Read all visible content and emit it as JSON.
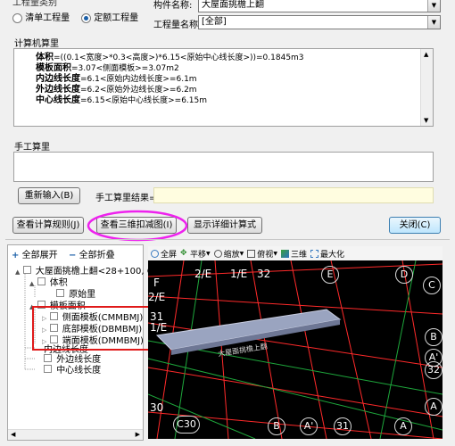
{
  "top": {
    "section_label": "工程量类别",
    "radio_list": "清单工程量",
    "radio_quota": "定额工程量",
    "component_name_label": "构件名称:",
    "component_name_value": "大屋面挑檐上翻",
    "quantity_name_label": "工程量名称:",
    "quantity_name_value": "[全部]"
  },
  "computer_calc": {
    "title": "计算机算里",
    "lines": [
      {
        "name": "体积",
        "expr": "=((0.1<宽度>*0.3<高度>)*6.15<原始中心线长度>))=0.1845m3"
      },
      {
        "name": "模板面积",
        "expr": "=3.07<侧面模板>=3.07m2"
      },
      {
        "name": "内边线长度",
        "expr": "=6.1<原始内边线长度>=6.1m"
      },
      {
        "name": "外边线长度",
        "expr": "=6.2<原始外边线长度>=6.2m"
      },
      {
        "name": "中心线长度",
        "expr": "=6.15<原始中心线长度>=6.15m"
      }
    ]
  },
  "manual_calc": {
    "title": "手工算里",
    "reenter_button": "重新输入(B)",
    "result_label": "手工算里结果="
  },
  "actions": {
    "view_rules": "查看计算规则(J)",
    "view_3d": "查看三维扣减图(I)",
    "show_detail": "显示详细计算式",
    "close": "关闭(C)"
  },
  "tree": {
    "expand_all": "全部展开",
    "collapse_all": "全部折叠",
    "root": "大屋面挑檐上翻<28+100, C-",
    "volume": "体积",
    "original_qty": "原始里",
    "formwork": "模板面积",
    "side_form": "侧面模板(CMMBMJ)",
    "bottom_form": "底部模板(DBMBMJ)",
    "end_form": "端面模板(DMMBMJ)",
    "inner_line": "内边线长度",
    "outer_line": "外边线长度",
    "center_line": "中心线长度"
  },
  "viewer_toolbar": {
    "full_screen": "全屏",
    "pan": "平移",
    "zoom": "缩放",
    "top_view": "俯视",
    "three_d": "三维",
    "maximize": "最大化"
  },
  "viewer": {
    "beam_label": "大屋面挑檐上翻",
    "labels": {
      "f": "F",
      "two_e_top": "2/E",
      "one_e": "1/E",
      "n32_top": "32",
      "e_top": "E",
      "d_top": "D",
      "c_right": "C",
      "two_e_left": "2/E",
      "n31_left": "31",
      "n1e_left": "1/E",
      "b_right": "B",
      "a_prime_right": "A'",
      "n32_right": "32",
      "n30": "30",
      "c30": "C30",
      "b_bottom": "B",
      "a_prime_bottom": "A'",
      "n31_bottom": "31",
      "a_bottom": "A",
      "a_right": "A"
    }
  },
  "colors": {
    "annotation_magenta": "#ee22ee",
    "annotation_red": "#e01a1a",
    "canvas": "#000000",
    "grid_red": "#ff2a2a",
    "grid_green": "#1ea83c"
  }
}
